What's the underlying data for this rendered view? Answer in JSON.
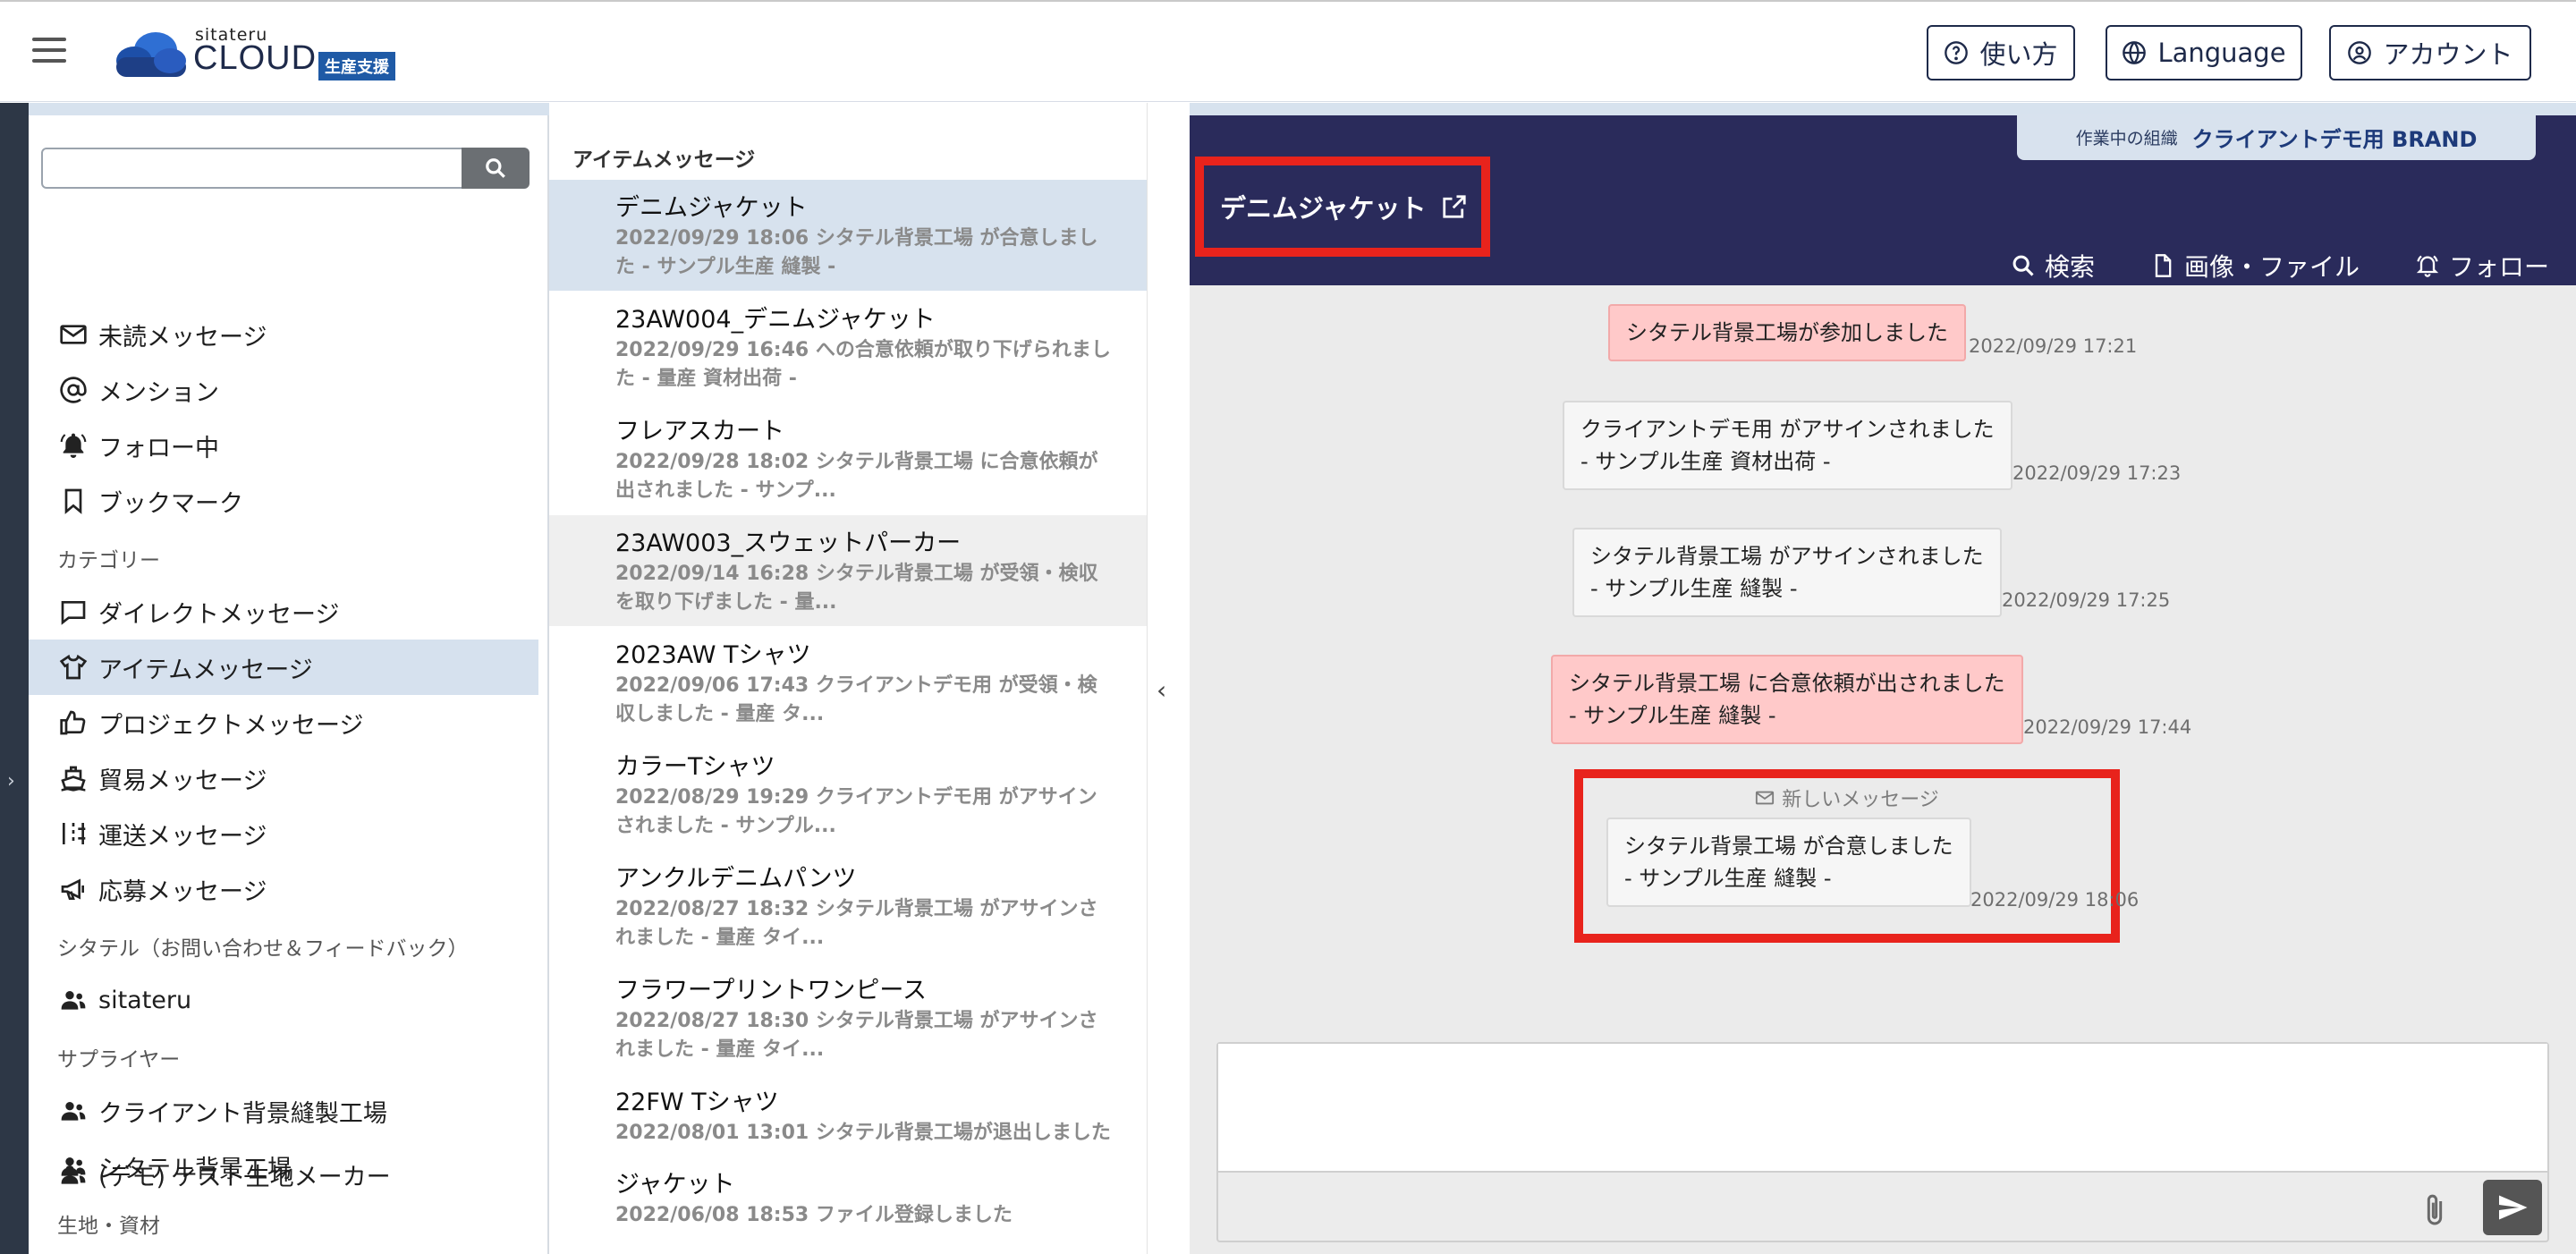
{
  "header": {
    "logo_small": "sitateru",
    "logo_big": "CLOUD",
    "logo_badge": "生産支援",
    "help_label": "使い方",
    "language_label": "Language",
    "account_label": "アカウント"
  },
  "sidebar": {
    "search_placeholder": "",
    "items": [
      {
        "label": "未読メッセージ"
      },
      {
        "label": "メンション"
      },
      {
        "label": "フォロー中"
      },
      {
        "label": "ブックマーク"
      }
    ],
    "category_label": "カテゴリー",
    "categories": [
      {
        "label": "ダイレクトメッセージ"
      },
      {
        "label": "アイテムメッセージ"
      },
      {
        "label": "プロジェクトメッセージ"
      },
      {
        "label": "貿易メッセージ"
      },
      {
        "label": "運送メッセージ"
      },
      {
        "label": "応募メッセージ"
      }
    ],
    "support_label": "シタテル（お問い合わせ＆フィードバック）",
    "support_item": "sitateru",
    "supplier_label": "サプライヤー",
    "suppliers": [
      {
        "label": "クライアント背景縫製工場"
      },
      {
        "label": "シタテル背景工場"
      }
    ],
    "fabric_label": "生地・資材",
    "fabric_item": "(デモ) テスト生地メーカー"
  },
  "item_list": {
    "header": "アイテムメッセージ",
    "items": [
      {
        "title": "デニムジャケット",
        "sub": "2022/09/29 18:06  シタテル背景工場 が合意しました - サンプル生産 縫製 -"
      },
      {
        "title": "23AW004_デニムジャケット",
        "sub": "2022/09/29 16:46  への合意依頼が取り下げられました - 量産 資材出荷 -"
      },
      {
        "title": "フレアスカート",
        "sub": "2022/09/28 18:02  シタテル背景工場 に合意依頼が出されました - サンプ..."
      },
      {
        "title": "23AW003_スウェットパーカー",
        "sub": "2022/09/14 16:28  シタテル背景工場 が受領・検収を取り下げました - 量..."
      },
      {
        "title": "2023AW Tシャツ",
        "sub": "2022/09/06 17:43  クライアントデモ用 が受領・検収しました - 量産 タ..."
      },
      {
        "title": "カラーTシャツ",
        "sub": "2022/08/29 19:29  クライアントデモ用 がアサインされました - サンプル..."
      },
      {
        "title": "アンクルデニムパンツ",
        "sub": "2022/08/27 18:32  シタテル背景工場 がアサインされました - 量産 タイ..."
      },
      {
        "title": "フラワープリントワンピース",
        "sub": "2022/08/27 18:30  シタテル背景工場 がアサインされました - 量産 タイ..."
      },
      {
        "title": "22FW Tシャツ",
        "sub": "2022/08/01 13:01  シタテル背景工場が退出しました"
      },
      {
        "title": "ジャケット",
        "sub": "2022/06/08 18:53  ファイル登録しました"
      }
    ]
  },
  "chat": {
    "org_label": "作業中の組織",
    "org_name": "クライアントデモ用 BRAND",
    "title": "デニムジャケット",
    "actions": {
      "search": "検索",
      "files": "画像・ファイル",
      "follow": "フォロー"
    },
    "messages": [
      {
        "line1": "シタテル背景工場が参加しました",
        "line2": "",
        "time": "2022/09/29 17:21",
        "style": "pink"
      },
      {
        "line1": "クライアントデモ用 がアサインされました",
        "line2": "- サンプル生産 資材出荷 -",
        "time": "2022/09/29 17:23",
        "style": "gray"
      },
      {
        "line1": "シタテル背景工場 がアサインされました",
        "line2": "- サンプル生産 縫製 -",
        "time": "2022/09/29 17:25",
        "style": "gray"
      },
      {
        "line1": "シタテル背景工場 に合意依頼が出されました",
        "line2": "- サンプル生産 縫製 -",
        "time": "2022/09/29 17:44",
        "style": "pink"
      },
      {
        "line1": "シタテル背景工場 が合意しました",
        "line2": "- サンプル生産 縫製 -",
        "time": "2022/09/29 18:06",
        "style": "gray"
      }
    ],
    "new_message_label": "新しいメッセージ",
    "composer_placeholder": ""
  },
  "colors": {
    "chat_header": "#2a2b5b",
    "highlight_red": "#e8231c",
    "selected_row": "#d7e2ee",
    "pink_bubble": "#ffc9c9"
  }
}
